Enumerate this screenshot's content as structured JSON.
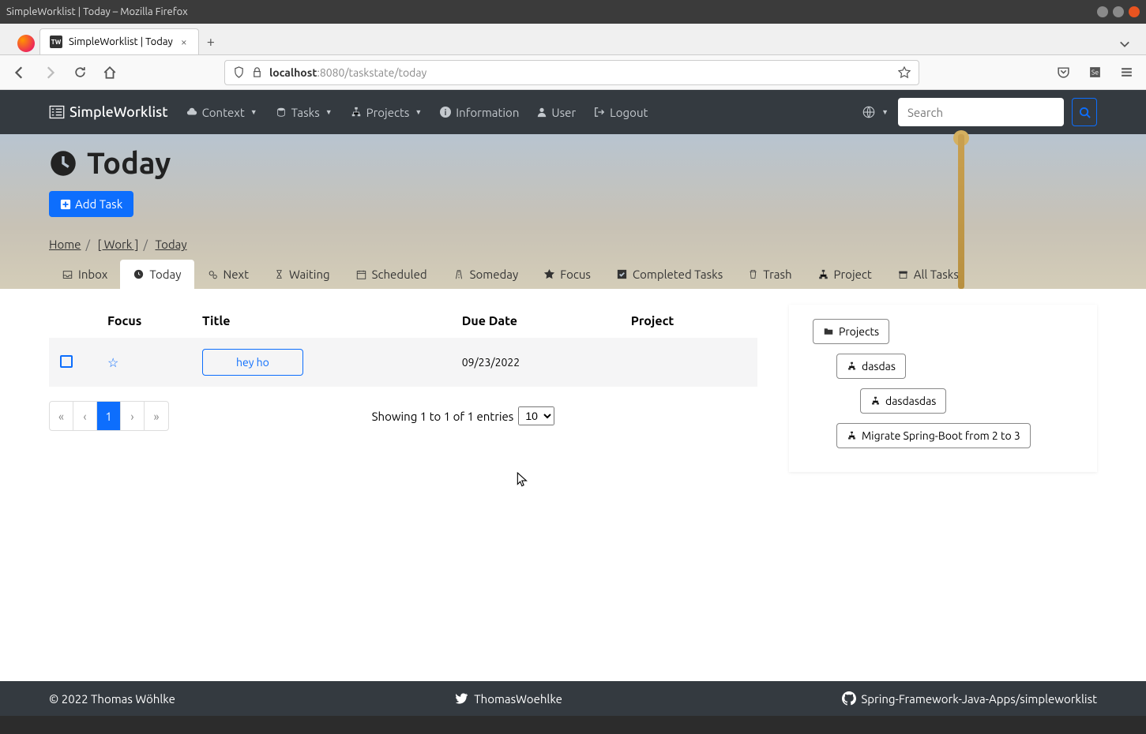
{
  "window": {
    "title": "SimpleWorklist | Today – Mozilla Firefox"
  },
  "tab": {
    "title": "SimpleWorklist | Today",
    "favicon": "TW"
  },
  "url": {
    "host": "localhost",
    "port": ":8080",
    "path": "/taskstate/today"
  },
  "nav": {
    "brand": "SimpleWorklist",
    "context": "Context",
    "tasks": "Tasks",
    "projects": "Projects",
    "information": "Information",
    "user": "User",
    "logout": "Logout",
    "search_placeholder": "Search"
  },
  "page": {
    "title": "Today",
    "add_task": "Add Task",
    "breadcrumb": {
      "home": "Home",
      "work": "[ Work ]",
      "today": "Today"
    }
  },
  "tabs": {
    "inbox": "Inbox",
    "today": "Today",
    "next": "Next",
    "waiting": "Waiting",
    "scheduled": "Scheduled",
    "someday": "Someday",
    "focus": "Focus",
    "completed": "Completed Tasks",
    "trash": "Trash",
    "project": "Project",
    "all": "All Tasks"
  },
  "table": {
    "headers": {
      "focus": "Focus",
      "title": "Title",
      "due": "Due Date",
      "project": "Project"
    },
    "rows": [
      {
        "title": "hey ho",
        "due": "09/23/2022",
        "project": ""
      }
    ]
  },
  "pager": {
    "first": "«",
    "prev": "‹",
    "current": "1",
    "next": "›",
    "last": "»",
    "entries_text": "Showing 1 to 1 of 1 entries",
    "page_size": "10"
  },
  "sidebar": {
    "projects": "Projects",
    "items": [
      "dasdas",
      "dasdasdas",
      "Migrate Spring-Boot from 2 to 3"
    ]
  },
  "footer": {
    "copyright": "© 2022 Thomas Wöhlke",
    "twitter": "ThomasWoehlke",
    "github": "Spring-Framework-Java-Apps/simpleworklist"
  }
}
